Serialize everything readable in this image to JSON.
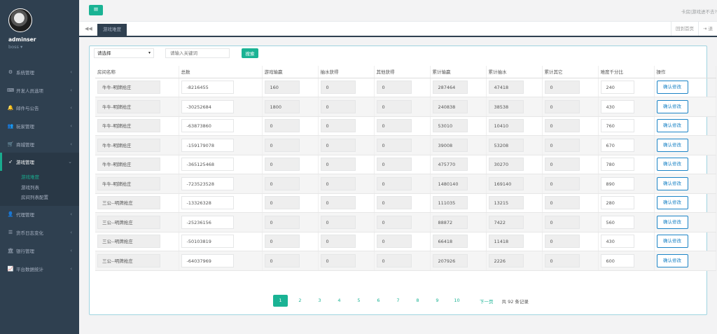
{
  "sidebar": {
    "username": "adminser",
    "role": "boss",
    "items": [
      {
        "label": "系统管理",
        "icon": "gear-icon",
        "glyph": "⚙"
      },
      {
        "label": "开发人员选项",
        "icon": "code-icon",
        "glyph": "⌨"
      },
      {
        "label": "邮件与公告",
        "icon": "bell-icon",
        "glyph": "🔔"
      },
      {
        "label": "玩家管理",
        "icon": "users-icon",
        "glyph": "👥"
      },
      {
        "label": "商城管理",
        "icon": "cart-icon",
        "glyph": "🛒"
      },
      {
        "label": "游戏管理",
        "icon": "rocket-icon",
        "glyph": "➶"
      },
      {
        "label": "代理管理",
        "icon": "people-icon",
        "glyph": "👤"
      },
      {
        "label": "货币日志变化",
        "icon": "list-icon",
        "glyph": "☰"
      },
      {
        "label": "银行管理",
        "icon": "bank-icon",
        "glyph": "🏛"
      },
      {
        "label": "平台数据统计",
        "icon": "chart-icon",
        "glyph": "📈"
      }
    ],
    "submenu": [
      "游戏难度",
      "游戏列表",
      "房间列表配置"
    ]
  },
  "topbar": {
    "message": "卡房|游戏进不去?"
  },
  "tabs": {
    "active": "游戏难度",
    "back_home": "回到首页",
    "right_extra": "退"
  },
  "search": {
    "select_value": "请选择",
    "keyword_placeholder": "请输入关键词",
    "button": "搜索"
  },
  "table": {
    "headers": [
      "房间名称",
      "总数",
      "游戏输赢",
      "抽水获得",
      "其他获得",
      "累计输赢",
      "累计抽水",
      "累计其它",
      "难度千分比",
      "操作"
    ],
    "action_label": "确认修改",
    "rows": [
      {
        "name": "牛牛-明牌抢庄",
        "total": "-8216455",
        "win": "160",
        "rake": "0",
        "other": "0",
        "acc_win": "287464",
        "acc_rake": "47418",
        "acc_other": "0",
        "rate": "240"
      },
      {
        "name": "牛牛-明牌抢庄",
        "total": "-30252684",
        "win": "1800",
        "rake": "0",
        "other": "0",
        "acc_win": "240838",
        "acc_rake": "38538",
        "acc_other": "0",
        "rate": "430"
      },
      {
        "name": "牛牛-明牌抢庄",
        "total": "-63873860",
        "win": "0",
        "rake": "0",
        "other": "0",
        "acc_win": "53010",
        "acc_rake": "10410",
        "acc_other": "0",
        "rate": "760"
      },
      {
        "name": "牛牛-明牌抢庄",
        "total": "-159179078",
        "win": "0",
        "rake": "0",
        "other": "0",
        "acc_win": "39008",
        "acc_rake": "53208",
        "acc_other": "0",
        "rate": "670"
      },
      {
        "name": "牛牛-明牌抢庄",
        "total": "-365125468",
        "win": "0",
        "rake": "0",
        "other": "0",
        "acc_win": "475770",
        "acc_rake": "30270",
        "acc_other": "0",
        "rate": "780"
      },
      {
        "name": "牛牛-明牌抢庄",
        "total": "-723523528",
        "win": "0",
        "rake": "0",
        "other": "0",
        "acc_win": "1480140",
        "acc_rake": "169140",
        "acc_other": "0",
        "rate": "890"
      },
      {
        "name": "三公--明牌抢庄",
        "total": "-13326328",
        "win": "0",
        "rake": "0",
        "other": "0",
        "acc_win": "111035",
        "acc_rake": "13215",
        "acc_other": "0",
        "rate": "280"
      },
      {
        "name": "三公--明牌抢庄",
        "total": "-25236156",
        "win": "0",
        "rake": "0",
        "other": "0",
        "acc_win": "88872",
        "acc_rake": "7422",
        "acc_other": "0",
        "rate": "560"
      },
      {
        "name": "三公--明牌抢庄",
        "total": "-50103819",
        "win": "0",
        "rake": "0",
        "other": "0",
        "acc_win": "66418",
        "acc_rake": "11418",
        "acc_other": "0",
        "rate": "430"
      },
      {
        "name": "三公--明牌抢庄",
        "total": "-64037969",
        "win": "0",
        "rake": "0",
        "other": "0",
        "acc_win": "207926",
        "acc_rake": "2226",
        "acc_other": "0",
        "rate": "600"
      }
    ]
  },
  "pagination": {
    "pages": [
      "1",
      "2",
      "3",
      "4",
      "5",
      "6",
      "7",
      "8",
      "9",
      "10"
    ],
    "current": "1",
    "next": "下一页",
    "total": "共 92 条记录"
  },
  "colors": {
    "accent": "#1ab394",
    "sidebar": "#2f4050",
    "link": "#1c84c6"
  }
}
